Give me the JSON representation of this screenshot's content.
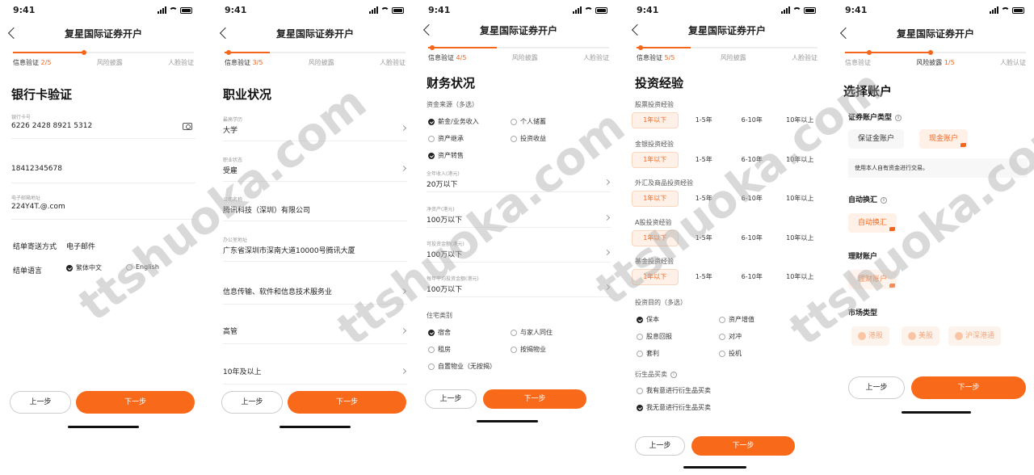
{
  "status_time": "9:41",
  "app_title": "复星国际证券开户",
  "prev_label": "上一步",
  "next_label": "下一步",
  "accent": "#f86a1a",
  "watermark": "ttshuoka.com",
  "steps": {
    "s1": {
      "current": "信息验证",
      "num": "2/5",
      "mid": "风险披露",
      "last": "人脸验证"
    },
    "s2": {
      "current": "信息验证",
      "num": "3/5",
      "mid": "风险披露",
      "last": "人脸验证"
    },
    "s3": {
      "current": "信息验证",
      "num": "4/5",
      "mid": "风险披露",
      "last": "人脸验证"
    },
    "s4": {
      "current": "信息验证",
      "num": "5/5",
      "mid": "风险披露",
      "last": "人脸验证"
    },
    "s5": {
      "first": "信息验证",
      "current": "风险披露",
      "num": "1/5",
      "last": "人脸认证"
    }
  },
  "screen1": {
    "title": "银行卡验证",
    "card_label": "银行卡号",
    "card_value": "6226 2428 8921 5312",
    "phone_value": "18412345678",
    "email_label": "电子邮箱地址",
    "email_value": "224Y4T.@.com",
    "delivery_label": "结单寄送方式",
    "delivery_value": "电子邮件",
    "lang_label": "结单语言",
    "lang_opt1": "繁体中文",
    "lang_opt2": "English"
  },
  "screen2": {
    "title": "职业状况",
    "fields": [
      {
        "label": "最高学历",
        "value": "大学"
      },
      {
        "label": "职业状态",
        "value": "受雇"
      },
      {
        "label": "公司名称",
        "value": "腾讯科技（深圳）有限公司"
      },
      {
        "label": "办公室地址",
        "value": "广东省深圳市深南大道10000号腾讯大厦"
      },
      {
        "label": "",
        "value": "信息传输、软件和信息技术服务业"
      },
      {
        "label": "",
        "value": "高管"
      },
      {
        "label": "",
        "value": "10年及以上"
      }
    ]
  },
  "screen3": {
    "title": "财务状况",
    "source_label": "资金来源（多选）",
    "sources": [
      {
        "label": "薪金/业务收入",
        "checked": true
      },
      {
        "label": "个人储蓄",
        "checked": false
      },
      {
        "label": "资产继承",
        "checked": false
      },
      {
        "label": "投资收益",
        "checked": false
      },
      {
        "label": "资产转售",
        "checked": true
      }
    ],
    "fields": [
      {
        "label": "全年收入(港元)",
        "value": "20万以下"
      },
      {
        "label": "净资产(港元)",
        "value": "100万以下"
      },
      {
        "label": "可投资金额(港元)",
        "value": "100万以下"
      },
      {
        "label": "每年平均投资金额(港元)",
        "value": "100万以下"
      }
    ],
    "housing_label": "住宅类别",
    "housing": [
      {
        "label": "宿舍",
        "checked": true
      },
      {
        "label": "与家人同住",
        "checked": false
      },
      {
        "label": "租房",
        "checked": false
      },
      {
        "label": "按揭物业",
        "checked": false
      },
      {
        "label": "自置物业（无按揭）",
        "checked": false
      }
    ]
  },
  "screen4": {
    "title": "投资经验",
    "chip_opts": [
      "1年以下",
      "1-5年",
      "6-10年",
      "10年以上"
    ],
    "groups": [
      "股票投资经验",
      "金银投资经验",
      "外汇及商品投资经验",
      "A股投资经验",
      "基金投资经验"
    ],
    "purpose_label": "投资目的（多选）",
    "purposes": [
      {
        "label": "保本",
        "checked": true
      },
      {
        "label": "资产增值",
        "checked": false
      },
      {
        "label": "股息回报",
        "checked": false
      },
      {
        "label": "对冲",
        "checked": false
      },
      {
        "label": "套利",
        "checked": false
      },
      {
        "label": "投机",
        "checked": false
      }
    ],
    "deriv_label": "衍生品买卖",
    "deriv": [
      {
        "label": "我有意进行衍生品买卖",
        "checked": false
      },
      {
        "label": "我无意进行衍生品买卖",
        "checked": true
      }
    ]
  },
  "screen5": {
    "title": "选择账户",
    "acct_type_label": "证券账户类型",
    "acct_margin": "保证金账户",
    "acct_cash": "现金账户",
    "acct_note": "使用本人自有资金进行交易。",
    "autofx_label": "自动换汇",
    "autofx_chip": "自动换汇",
    "wealth_label": "理财账户",
    "wealth_chip": "理财账户",
    "market_label": "市场类型",
    "markets": [
      "港股",
      "美股",
      "沪深港通"
    ]
  }
}
